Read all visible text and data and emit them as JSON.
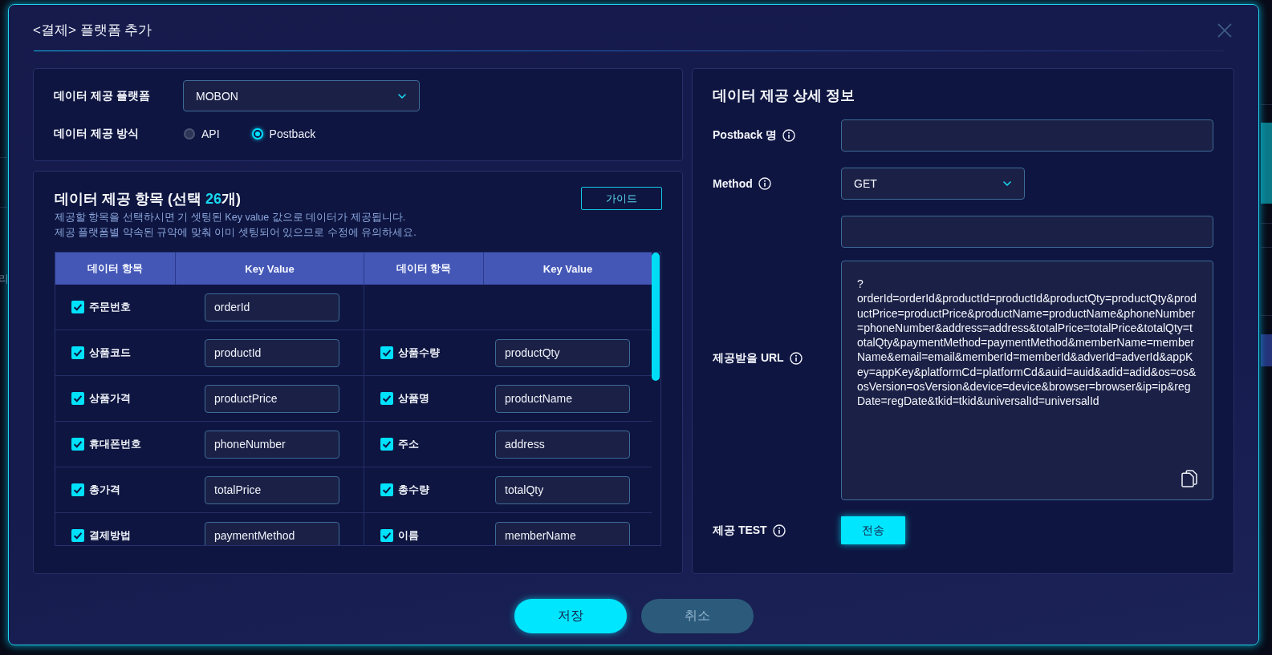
{
  "background": {
    "text": "리"
  },
  "dialog": {
    "title": "<결제> 플랫폼 추가"
  },
  "platform": {
    "label": "데이터 제공 플랫폼",
    "value": "MOBON"
  },
  "method": {
    "label": "데이터 제공 방식",
    "options": [
      {
        "label": "API",
        "selected": false
      },
      {
        "label": "Postback",
        "selected": true
      }
    ]
  },
  "items": {
    "title": "데이터 제공 항목 (선택 ",
    "count": "26",
    "title_end": "개)",
    "guide_button": "가이드",
    "description": [
      "제공할 항목을 선택하시면 기 셋팅된 Key value 값으로 데이터가 제공됩니다.",
      "제공 플랫폼별 약속된 규약에 맞춰 이미 셋팅되어 있으므로 수정에 유의하세요."
    ],
    "table": {
      "columns": [
        "데이터 항목",
        "Key Value",
        "데이터 항목",
        "Key Value"
      ],
      "rows": [
        {
          "left": {
            "label": "주문번호",
            "checked": true,
            "key": "orderId"
          }
        },
        {
          "left": {
            "label": "상품코드",
            "checked": true,
            "key": "productId"
          },
          "right": {
            "label": "상품수량",
            "checked": true,
            "key": "productQty"
          }
        },
        {
          "left": {
            "label": "상품가격",
            "checked": true,
            "key": "productPrice"
          },
          "right": {
            "label": "상품명",
            "checked": true,
            "key": "productName"
          }
        },
        {
          "left": {
            "label": "휴대폰번호",
            "checked": true,
            "key": "phoneNumber"
          },
          "right": {
            "label": "주소",
            "checked": true,
            "key": "address"
          }
        },
        {
          "left": {
            "label": "총가격",
            "checked": true,
            "key": "totalPrice"
          },
          "right": {
            "label": "총수량",
            "checked": true,
            "key": "totalQty"
          }
        },
        {
          "left": {
            "label": "결제방법",
            "checked": true,
            "key": "paymentMethod"
          },
          "right": {
            "label": "이름",
            "checked": true,
            "key": "memberName"
          }
        }
      ]
    }
  },
  "detail": {
    "title": "데이터 제공 상세 정보",
    "fields": [
      {
        "kind": "text",
        "label": "Postback 명"
      },
      {
        "kind": "select",
        "label": "Method",
        "value": "GET"
      },
      {
        "kind": "url",
        "label": "제공받을 URL",
        "query": "?orderId=orderId&productId=productId&productQty=productQty&productPrice=productPrice&productName=productName&phoneNumber=phoneNumber&address=address&totalPrice=totalPrice&totalQty=totalQty&paymentMethod=paymentMethod&memberName=memberName&email=email&memberId=memberId&adverId=adverId&appKey=appKey&platformCd=platformCd&auid=auid&adid=adid&os=os&osVersion=osVersion&device=device&browser=browser&ip=ip&regDate=regDate&tkid=tkid&universalId=universalId"
      },
      {
        "kind": "action",
        "label": "제공 TEST",
        "button": "전송"
      }
    ]
  },
  "footer": {
    "buttons": [
      {
        "kind": "primary",
        "label": "저장"
      },
      {
        "kind": "secondary",
        "label": "취소"
      }
    ]
  }
}
